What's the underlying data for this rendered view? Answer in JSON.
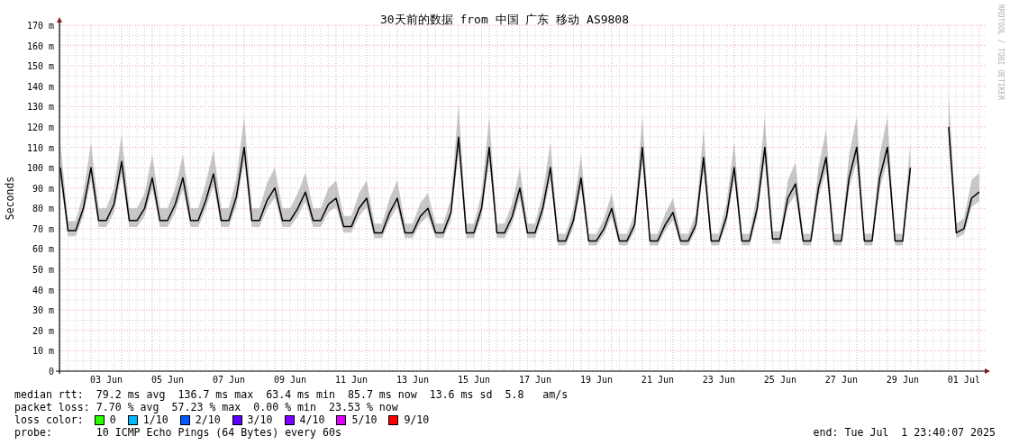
{
  "chart": {
    "chart_data": {
      "type": "line",
      "title": "30天前的数据 from 中国 广东 移动 AS9808",
      "ylabel": "Seconds",
      "categories": [
        null,
        null,
        null,
        null,
        null,
        null,
        "03 Jun",
        null,
        null,
        null,
        null,
        null,
        null,
        null,
        "05 Jun",
        null,
        null,
        null,
        null,
        null,
        null,
        null,
        "07 Jun",
        null,
        null,
        null,
        null,
        null,
        null,
        null,
        "09 Jun",
        null,
        null,
        null,
        null,
        null,
        null,
        null,
        "11 Jun",
        null,
        null,
        null,
        null,
        null,
        null,
        null,
        "13 Jun",
        null,
        null,
        null,
        null,
        null,
        null,
        null,
        "15 Jun",
        null,
        null,
        null,
        null,
        null,
        null,
        null,
        "17 Jun",
        null,
        null,
        null,
        null,
        null,
        null,
        null,
        "19 Jun",
        null,
        null,
        null,
        null,
        null,
        null,
        null,
        "21 Jun",
        null,
        null,
        null,
        null,
        null,
        null,
        null,
        "23 Jun",
        null,
        null,
        null,
        null,
        null,
        null,
        null,
        "25 Jun",
        null,
        null,
        null,
        null,
        null,
        null,
        null,
        "27 Jun",
        null,
        null,
        null,
        null,
        null,
        null,
        null,
        "29 Jun",
        null,
        null,
        null,
        null,
        null,
        null,
        null,
        "01 Jul",
        null,
        null
      ],
      "series": [
        {
          "color": "#000000",
          "values": [
            100,
            69,
            69,
            80,
            100,
            74,
            74,
            82,
            103,
            74,
            74,
            80,
            95,
            74,
            74,
            82,
            95,
            74,
            74,
            84,
            97,
            74,
            74,
            86,
            110,
            74,
            74,
            84,
            90,
            74,
            74,
            80,
            88,
            74,
            74,
            82,
            85,
            71,
            71,
            80,
            85,
            68,
            68,
            78,
            85,
            68,
            68,
            76,
            80,
            68,
            68,
            78,
            115,
            68,
            68,
            80,
            110,
            68,
            68,
            76,
            90,
            68,
            68,
            80,
            100,
            64,
            64,
            74,
            95,
            64,
            64,
            70,
            80,
            64,
            64,
            72,
            110,
            64,
            64,
            72,
            78,
            64,
            64,
            72,
            105,
            64,
            64,
            76,
            100,
            64,
            64,
            80,
            110,
            65,
            65,
            85,
            92,
            64,
            64,
            90,
            105,
            64,
            64,
            95,
            110,
            64,
            64,
            95,
            110,
            64,
            64,
            100,
            null,
            null,
            null,
            null,
            120,
            68,
            70,
            85,
            88
          ]
        }
      ],
      "ylim": [
        0,
        170
      ],
      "grid": true,
      "yticks": [
        {
          "value": 0,
          "label": "0"
        },
        {
          "value": 10,
          "label": "10 m"
        },
        {
          "value": 20,
          "label": "20 m"
        },
        {
          "value": 30,
          "label": "30 m"
        },
        {
          "value": 40,
          "label": "40 m"
        },
        {
          "value": 50,
          "label": "50 m"
        },
        {
          "value": 60,
          "label": "60 m"
        },
        {
          "value": 70,
          "label": "70 m"
        },
        {
          "value": 80,
          "label": "80 m"
        },
        {
          "value": 90,
          "label": "90 m"
        },
        {
          "value": 100,
          "label": "100 m"
        },
        {
          "value": 110,
          "label": "110 m"
        },
        {
          "value": 120,
          "label": "120 m"
        },
        {
          "value": 130,
          "label": "130 m"
        },
        {
          "value": 140,
          "label": "140 m"
        },
        {
          "value": 150,
          "label": "150 m"
        },
        {
          "value": 160,
          "label": "160 m"
        },
        {
          "value": 170,
          "label": "170 m"
        }
      ]
    },
    "credit": "RRDTOOL / TOBI OETIKER"
  },
  "legend": {
    "median_rtt": "median rtt:  79.2 ms avg  136.7 ms max  63.4 ms min  85.7 ms now  13.6 ms sd  5.8   am/s",
    "packet_loss": "packet loss: 7.70 % avg  57.23 % max  0.00 % min  23.53 % now",
    "loss_color_label": "loss color:",
    "loss_colors": [
      {
        "label": "0",
        "color": "#26ff00"
      },
      {
        "label": "1/10",
        "color": "#00b8ff"
      },
      {
        "label": "2/10",
        "color": "#0059ff"
      },
      {
        "label": "3/10",
        "color": "#5e00ff"
      },
      {
        "label": "4/10",
        "color": "#7e00ff"
      },
      {
        "label": "5/10",
        "color": "#dd00ff"
      },
      {
        "label": "9/10",
        "color": "#ff0000"
      }
    ],
    "probe": "probe:       10 ICMP Echo Pings (64 Bytes) every 60s",
    "end": "end: Tue Jul  1 23:40:07 2025"
  }
}
